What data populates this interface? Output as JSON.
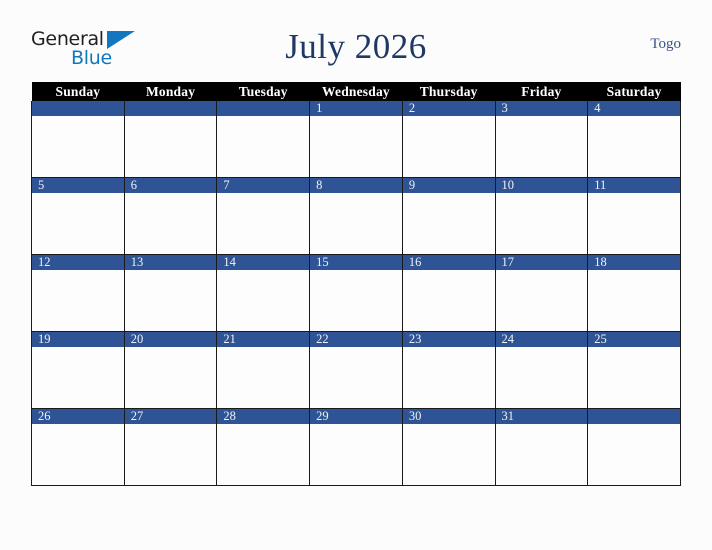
{
  "brand": {
    "word_one": "General",
    "word_two": "Blue",
    "triangle_icon": "blue-triangle-icon"
  },
  "header": {
    "title": "July 2026",
    "region": "Togo"
  },
  "calendar": {
    "weekday_headers": [
      "Sunday",
      "Monday",
      "Tuesday",
      "Wednesday",
      "Thursday",
      "Friday",
      "Saturday"
    ],
    "weeks": [
      [
        "",
        "",
        "",
        "1",
        "2",
        "3",
        "4"
      ],
      [
        "5",
        "6",
        "7",
        "8",
        "9",
        "10",
        "11"
      ],
      [
        "12",
        "13",
        "14",
        "15",
        "16",
        "17",
        "18"
      ],
      [
        "19",
        "20",
        "21",
        "22",
        "23",
        "24",
        "25"
      ],
      [
        "26",
        "27",
        "28",
        "29",
        "30",
        "31",
        ""
      ]
    ]
  },
  "colors": {
    "date_bar": "#2f5496",
    "header_bar": "#000000",
    "title_text": "#1f3864",
    "brand_blue": "#1277bf",
    "page_background": "#fcfcfc"
  }
}
